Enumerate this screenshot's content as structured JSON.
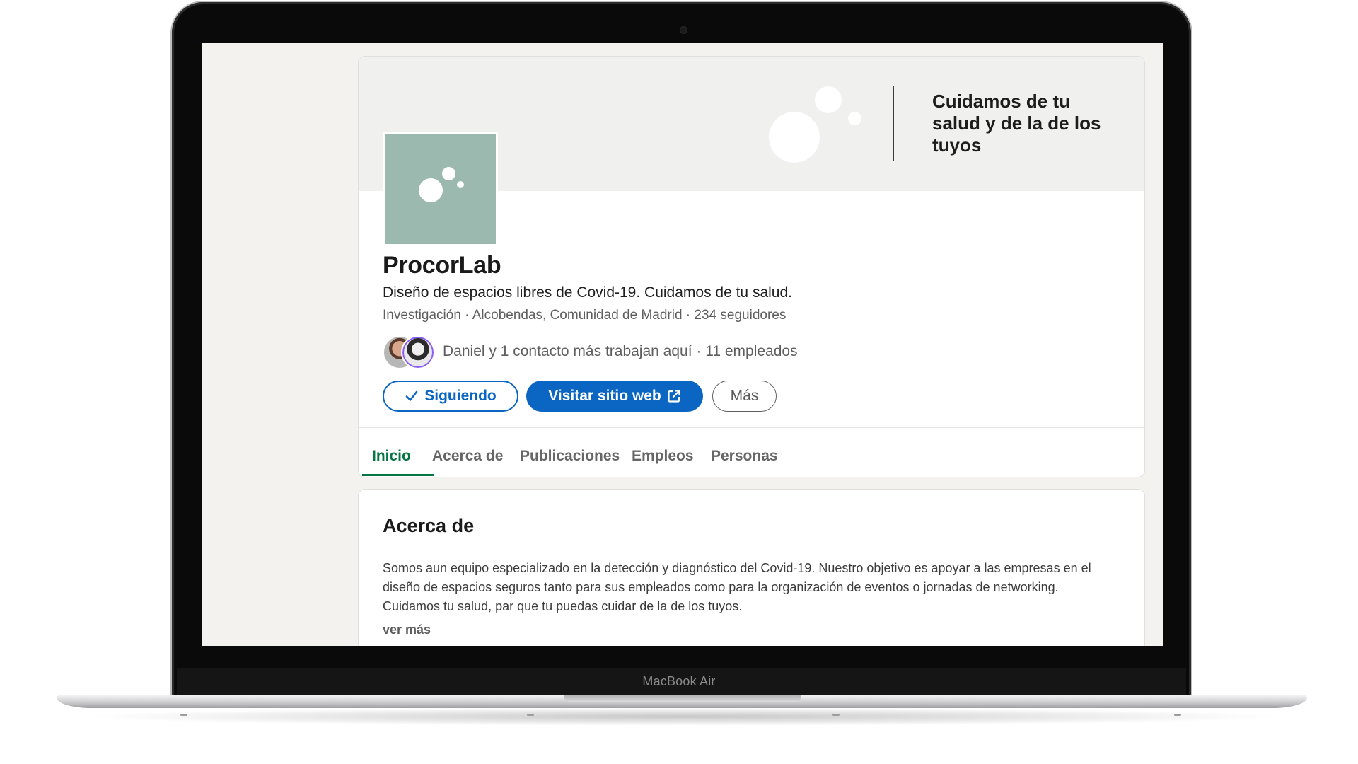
{
  "device": {
    "label": "MacBook Air"
  },
  "banner": {
    "tagline": "Cuidamos de tu salud y de la de los tuyos"
  },
  "company": {
    "name": "ProcorLab",
    "description": "Diseño de espacios libres de Covid-19. Cuidamos de tu salud.",
    "meta": "Investigación · Alcobendas, Comunidad de Madrid · 234 seguidores",
    "connections": "Daniel y 1 contacto más trabajan aquí · 11 empleados"
  },
  "actions": {
    "follow": "Siguiendo",
    "website": "Visitar sitio web",
    "more": "Más"
  },
  "tabs": [
    {
      "label": "Inicio",
      "active": true
    },
    {
      "label": "Acerca de",
      "active": false
    },
    {
      "label": "Publicaciones",
      "active": false
    },
    {
      "label": "Empleos",
      "active": false
    },
    {
      "label": "Personas",
      "active": false
    }
  ],
  "about": {
    "title": "Acerca de",
    "text": "Somos aun equipo especializado en la detección y diagnóstico del Covid-19. Nuestro objetivo es apoyar a las empresas en el diseño de espacios seguros tanto para sus empleados como para la organización de eventos o jornadas de networking. Cuidamos tu salud, par que tu puedas cuidar de la de los tuyos.",
    "see_more": "ver más"
  },
  "colors": {
    "brand_blue": "#0a66c2",
    "active_green": "#057642",
    "logo_bg": "#9cb9b0"
  },
  "icons": [
    "check-icon",
    "external-link-icon",
    "camera-icon"
  ]
}
